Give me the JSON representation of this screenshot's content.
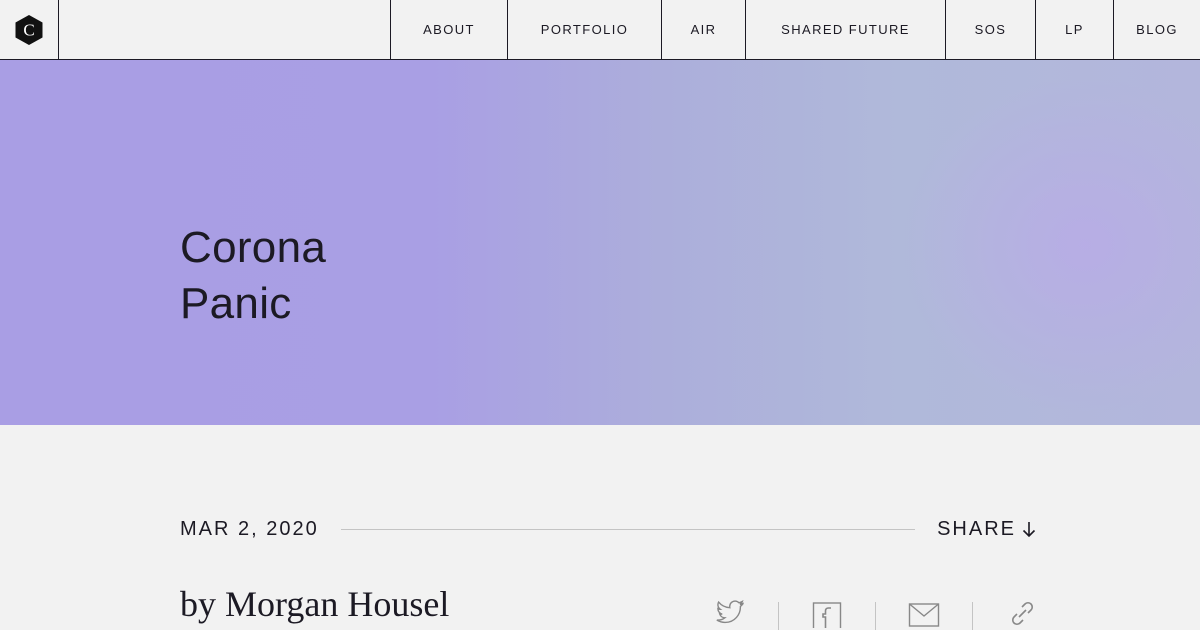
{
  "nav": {
    "logo_icon": "hexagon-c-logo-icon",
    "logo_letter": "C",
    "items": [
      {
        "label": "ABOUT"
      },
      {
        "label": "PORTFOLIO"
      },
      {
        "label": "AIR"
      },
      {
        "label": "SHARED FUTURE"
      },
      {
        "label": "SOS"
      },
      {
        "label": "LP"
      },
      {
        "label": "BLOG"
      }
    ]
  },
  "hero": {
    "title_line1": "Corona",
    "title_line2": "Panic",
    "colors": {
      "left": "#a99ee4",
      "right": "#b3b6dc"
    }
  },
  "article": {
    "date": "MAR 2, 2020",
    "share_label": "SHARE",
    "share_icon": "arrow-down-icon",
    "byline": "by Morgan Housel"
  },
  "share_icons": [
    "twitter-icon",
    "facebook-icon",
    "email-icon",
    "link-icon"
  ],
  "colors": {
    "text": "#1c1a24",
    "background": "#f2f2f2",
    "rule": "#c4c4c4"
  }
}
